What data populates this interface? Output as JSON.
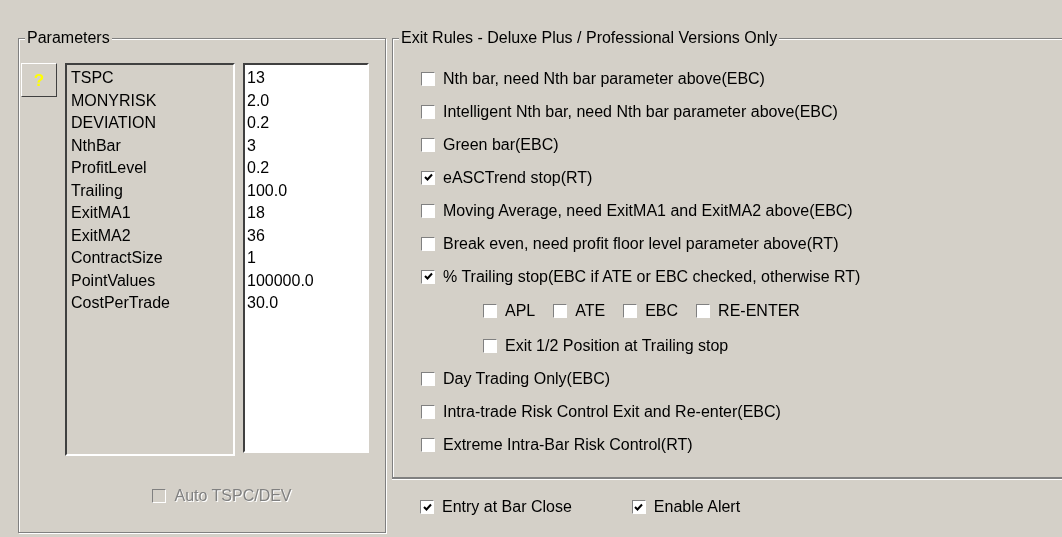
{
  "parameters": {
    "title": "Parameters",
    "help_button": "?",
    "rows": [
      {
        "name": "TSPC",
        "value": "13"
      },
      {
        "name": "MONYRISK",
        "value": "2.0"
      },
      {
        "name": "DEVIATION",
        "value": "0.2"
      },
      {
        "name": "NthBar",
        "value": "3"
      },
      {
        "name": "ProfitLevel",
        "value": "0.2"
      },
      {
        "name": "Trailing",
        "value": "100.0"
      },
      {
        "name": "ExitMA1",
        "value": "18"
      },
      {
        "name": "ExitMA2",
        "value": "36"
      },
      {
        "name": "ContractSize",
        "value": "1"
      },
      {
        "name": "PointValues",
        "value": "100000.0"
      },
      {
        "name": "CostPerTrade",
        "value": "30.0"
      }
    ],
    "auto_option": {
      "label": "Auto TSPC/DEV",
      "checked": false,
      "disabled": true
    }
  },
  "exit_rules": {
    "title": "Exit Rules - Deluxe Plus / Professional Versions Only",
    "rules": [
      {
        "kind": "check",
        "label": "Nth bar, need Nth bar parameter above(EBC)",
        "checked": false
      },
      {
        "kind": "check",
        "label": "Intelligent Nth bar, need Nth bar parameter above(EBC)",
        "checked": false
      },
      {
        "kind": "check",
        "label": "Green bar(EBC)",
        "checked": false
      },
      {
        "kind": "check",
        "label": "eASCTrend stop(RT)",
        "checked": true
      },
      {
        "kind": "check",
        "label": "Moving Average, need ExitMA1 and ExitMA2 above(EBC)",
        "checked": false
      },
      {
        "kind": "check",
        "label": "Break even, need profit floor level parameter above(RT)",
        "checked": false
      },
      {
        "kind": "check",
        "label": "% Trailing stop(EBC if ATE or EBC checked, otherwise RT)",
        "checked": true
      },
      {
        "kind": "inline",
        "items": [
          {
            "label": "APL",
            "checked": false
          },
          {
            "label": "ATE",
            "checked": false
          },
          {
            "label": "EBC",
            "checked": false
          },
          {
            "label": "RE-ENTER",
            "checked": false
          }
        ]
      },
      {
        "kind": "sub_check",
        "label": "Exit 1/2 Position at Trailing stop",
        "checked": false
      },
      {
        "kind": "check",
        "label": "Day Trading Only(EBC)",
        "checked": false
      },
      {
        "kind": "check",
        "label": "Intra-trade Risk Control Exit and Re-enter(EBC)",
        "checked": false
      },
      {
        "kind": "check",
        "label": "Extreme Intra-Bar Risk Control(RT)",
        "checked": false
      }
    ],
    "footer": [
      {
        "label": "Entry at Bar Close",
        "checked": true
      },
      {
        "label": "Enable Alert",
        "checked": true
      }
    ]
  }
}
